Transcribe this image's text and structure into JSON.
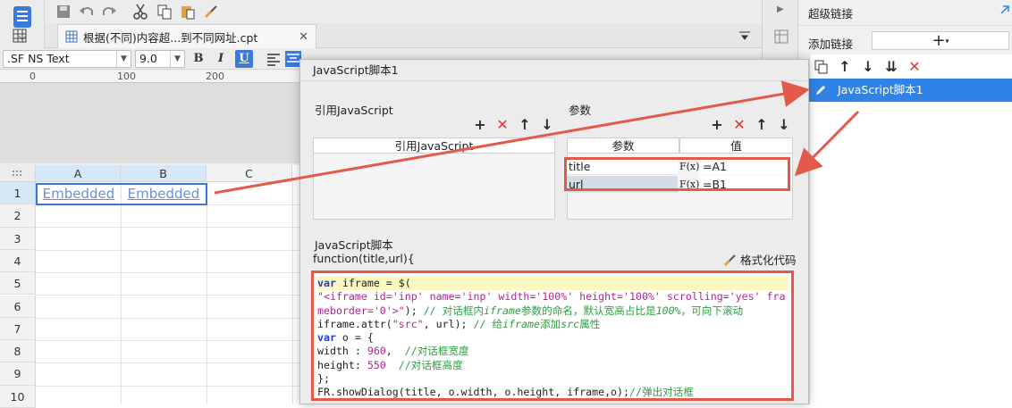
{
  "file_tab": {
    "title": "根据(不同)内容超...到不同网址.cpt"
  },
  "font": {
    "name": ".SF NS Text",
    "size": "9.0"
  },
  "format_buttons": [
    "B",
    "I",
    "U"
  ],
  "ruler": {
    "ticks": [
      "0",
      "100",
      "200"
    ]
  },
  "grid": {
    "columns": [
      "A",
      "B",
      "C"
    ],
    "rows": [
      "1",
      "2",
      "3",
      "4",
      "5",
      "6",
      "7",
      "8",
      "9",
      "10"
    ],
    "cells": {
      "A1": "Embedded",
      "B1": "Embedded"
    }
  },
  "dialog": {
    "title": "JavaScript脚本1",
    "ref_section_label": "引用JavaScript",
    "ref_table_header": "引用JavaScript",
    "params_section_label": "参数",
    "params_header_name": "参数",
    "params_header_value": "值",
    "params": [
      {
        "name": "title",
        "fx": "F(x)",
        "value": "=A1"
      },
      {
        "name": "url",
        "fx": "F(x)",
        "value": "=B1"
      }
    ],
    "script_section_label": "JavaScript脚本",
    "function_signature": "function(title,url){",
    "format_code_label": "格式化代码",
    "code_lines": [
      "var iframe = $(",
      "\"<iframe id='inp' name='inp' width='100%' height='100%' scrolling='yes' fra",
      "meborder='0'>\"); // 对话框内iframe参数的命名，默认宽高占比是100%，可向下滚动",
      "iframe.attr(\"src\", url); // 给iframe添加src属性",
      "var o = {",
      "width : 960,  //对话框宽度",
      "height: 550  //对话框高度",
      "};",
      "FR.showDialog(title, o.width, o.height, iframe,o);//弹出对话框"
    ]
  },
  "right_panel": {
    "title": "超级链接",
    "add_link_label": "添加链接",
    "add_symbol": "+",
    "link_items": [
      "JavaScript脚本1"
    ]
  },
  "colors": {
    "accent_blue": "#2f83e6",
    "annotation_red": "#e35a4b",
    "link_text": "#6a8fd8",
    "delete_red": "#e0352b"
  }
}
